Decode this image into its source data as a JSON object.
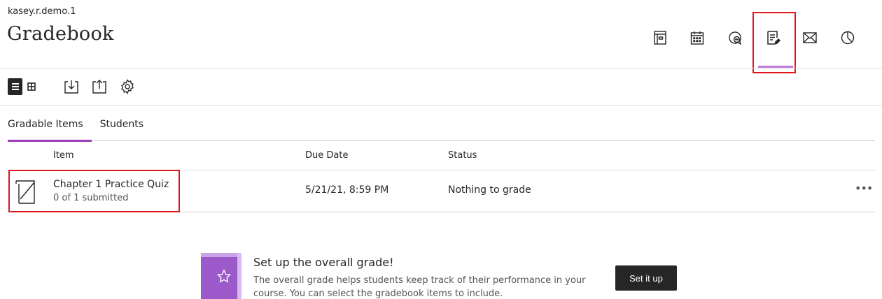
{
  "header": {
    "course_name": "kasey.r.demo.1",
    "page_title": "Gradebook"
  },
  "top_nav": {
    "icons": [
      "course-content-icon",
      "calendar-icon",
      "discussions-icon",
      "gradebook-icon",
      "messages-icon",
      "analytics-icon"
    ],
    "active": "gradebook-icon",
    "accent_color": "#c07ad6"
  },
  "toolbar": {
    "icons": [
      "list-view-icon",
      "grid-view-icon",
      "download-icon",
      "upload-icon",
      "settings-icon"
    ]
  },
  "tabs": [
    {
      "label": "Gradable Items",
      "active": true
    },
    {
      "label": "Students",
      "active": false
    }
  ],
  "table": {
    "headers": {
      "item": "Item",
      "due_date": "Due Date",
      "status": "Status"
    },
    "rows": [
      {
        "title": "Chapter 1 Practice Quiz",
        "subtitle": "0 of 1 submitted",
        "due_date": "5/21/21, 8:59 PM",
        "status": "Nothing to grade",
        "more": "•••"
      }
    ]
  },
  "banner": {
    "title": "Set up the overall grade!",
    "text": "The overall grade helps students keep track of their performance in your course. You can select the gradebook items to include.",
    "button_label": "Set it up"
  },
  "colors": {
    "highlight": "#e0161b",
    "tab_active": "#9b3bb8",
    "book_purple": "#9b59c9"
  }
}
